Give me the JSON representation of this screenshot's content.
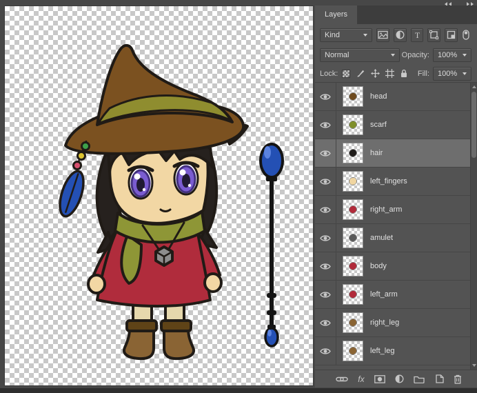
{
  "panel": {
    "tab_label": "Layers",
    "kind_label": "Kind",
    "blend_mode": "Normal",
    "opacity_label": "Opacity:",
    "opacity_value": "100%",
    "lock_label": "Lock:",
    "fill_label": "Fill:",
    "fill_value": "100%",
    "icons": {
      "type_filter_glyph": "T",
      "fx_glyph": "fx"
    },
    "layers": [
      {
        "name": "head",
        "visible": true,
        "selected": false,
        "thumb_color": "#6e4a1e"
      },
      {
        "name": "scarf",
        "visible": true,
        "selected": false,
        "thumb_color": "#7f8f2a"
      },
      {
        "name": "hair",
        "visible": true,
        "selected": true,
        "thumb_color": "#1f1c1a"
      },
      {
        "name": "left_fingers",
        "visible": true,
        "selected": false,
        "thumb_color": "#f0d5a0"
      },
      {
        "name": "right_arm",
        "visible": true,
        "selected": false,
        "thumb_color": "#b12a3a"
      },
      {
        "name": "amulet",
        "visible": true,
        "selected": false,
        "thumb_color": "#5a5a5a"
      },
      {
        "name": "body",
        "visible": true,
        "selected": false,
        "thumb_color": "#b12a3a"
      },
      {
        "name": "left_arm",
        "visible": true,
        "selected": false,
        "thumb_color": "#b12a3a"
      },
      {
        "name": "right_leg",
        "visible": true,
        "selected": false,
        "thumb_color": "#8a6434"
      },
      {
        "name": "left_leg",
        "visible": true,
        "selected": false,
        "thumb_color": "#8a6434"
      }
    ]
  },
  "colors": {
    "panel_bg": "#535353",
    "tab_strip": "#3d3d3d",
    "selected_row": "#6e6e6e",
    "panel_text": "#dcdcdc"
  },
  "character": {
    "subject": "chibi witch character with hat, scarf, amulet and blue-orb staff on transparent canvas",
    "palette": {
      "outline": "#201b16",
      "hat": "#7b5120",
      "band": "#8f8d2f",
      "hair": "#26211e",
      "skin": "#f2d7a4",
      "iris": "#7a5cd0",
      "iris_dark": "#43307e",
      "scarf": "#8e9636",
      "dress": "#b02c3c",
      "socks": "#e6d8ad",
      "boots": "#8a6434",
      "boots_dark": "#5f4317",
      "blue": "#2450b4",
      "blue_light": "#5b83e0",
      "bead_green": "#3da14a",
      "bead_yellow": "#ddc32f",
      "bead_pink": "#d7506e"
    }
  }
}
